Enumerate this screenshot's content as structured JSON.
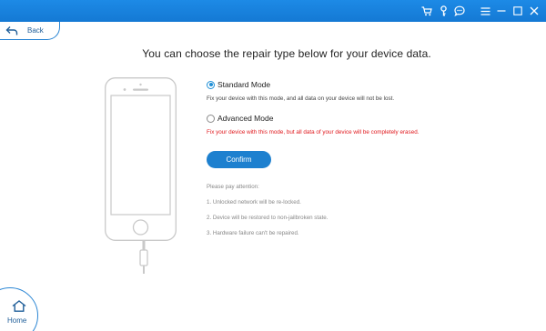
{
  "titlebar": {
    "icons": [
      "cart-icon",
      "key-icon",
      "chat-icon",
      "menu-icon",
      "minimize-icon",
      "maximize-icon",
      "close-icon"
    ],
    "accent": "#1479d4"
  },
  "nav": {
    "back_label": "Back",
    "home_label": "Home"
  },
  "main": {
    "heading": "You can choose the repair type below for your device data.",
    "options": [
      {
        "label": "Standard Mode",
        "selected": true,
        "description": "Fix your device with this mode, and all data on your device will not be lost."
      },
      {
        "label": "Advanced Mode",
        "selected": false,
        "description": "Fix your device with this mode, but all data of your device will be completely erased."
      }
    ],
    "confirm_label": "Confirm",
    "attention_title": "Please pay attention:",
    "attention_items": [
      "1. Unlocked network will be re-locked.",
      "2. Device will be restored to non-jailbroken state.",
      "3. Hardware failure can't be repaired."
    ]
  },
  "colors": {
    "warning": "#e0191e",
    "button": "#1d80cf"
  }
}
